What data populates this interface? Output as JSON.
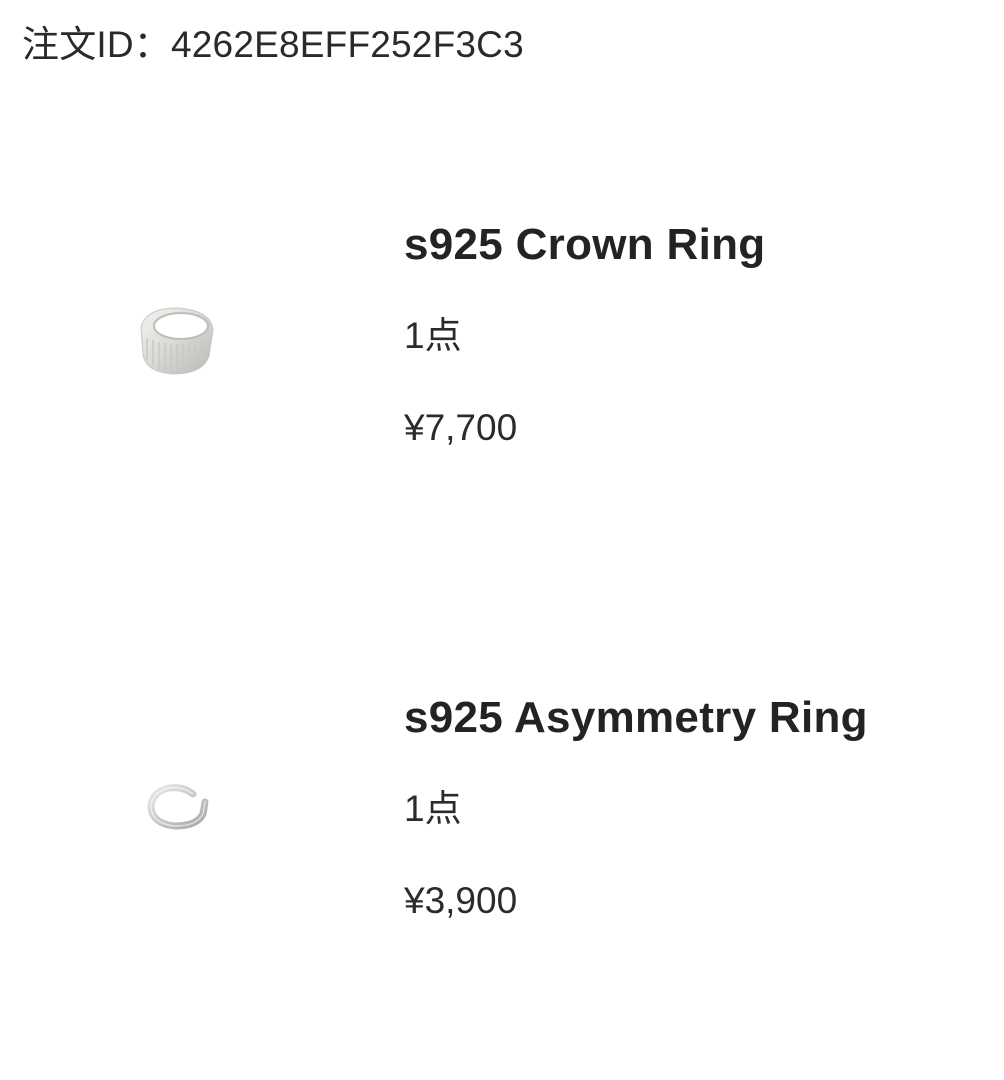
{
  "order": {
    "id_text": "注文ID：4262E8EFF252F3C3"
  },
  "items": [
    {
      "name": "s925 Crown Ring",
      "quantity": "1点",
      "price": "¥7,700",
      "image_icon": "crown-ring-image"
    },
    {
      "name": "s925 Asymmetry Ring",
      "quantity": "1点",
      "price": "¥3,900",
      "image_icon": "asymmetry-ring-image"
    }
  ]
}
